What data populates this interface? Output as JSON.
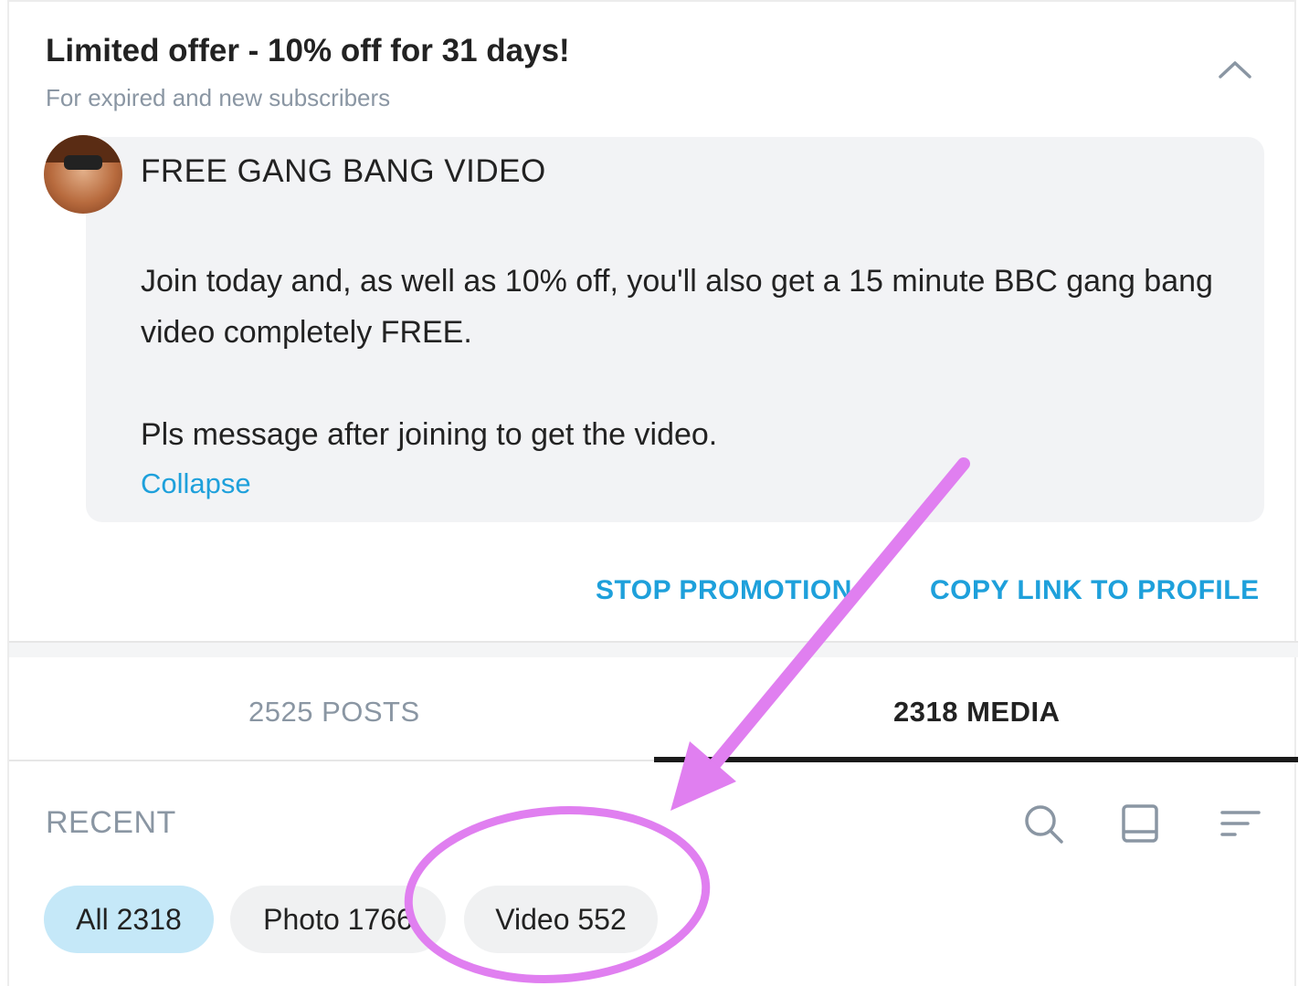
{
  "offer": {
    "title": "Limited offer - 10% off for 31 days!",
    "subtitle": "For expired and new subscribers"
  },
  "message": {
    "title": "FREE GANG BANG VIDEO",
    "body": "Join today and, as well as 10% off, you'll also get a 15 minute BBC gang bang video completely FREE.",
    "body2": "Pls message after joining to get the video.",
    "collapse_label": "Collapse"
  },
  "actions": {
    "stop_label": "STOP PROMOTION",
    "copy_label": "COPY LINK TO PROFILE"
  },
  "tabs": [
    {
      "label": "2525 POSTS",
      "active": false
    },
    {
      "label": "2318 MEDIA",
      "active": true
    }
  ],
  "media": {
    "section_label": "RECENT",
    "filters": [
      {
        "label": "All 2318",
        "selected": true
      },
      {
        "label": "Photo 1766",
        "selected": false
      },
      {
        "label": "Video 552",
        "selected": false
      }
    ]
  },
  "icons": {
    "chevron": "chevron-up-icon",
    "search": "search-icon",
    "grid": "layout-icon",
    "sort": "sort-icon"
  },
  "colors": {
    "accent": "#1ea0db",
    "chip_selected": "#c5e8f8",
    "annotation": "#e07ff0"
  }
}
